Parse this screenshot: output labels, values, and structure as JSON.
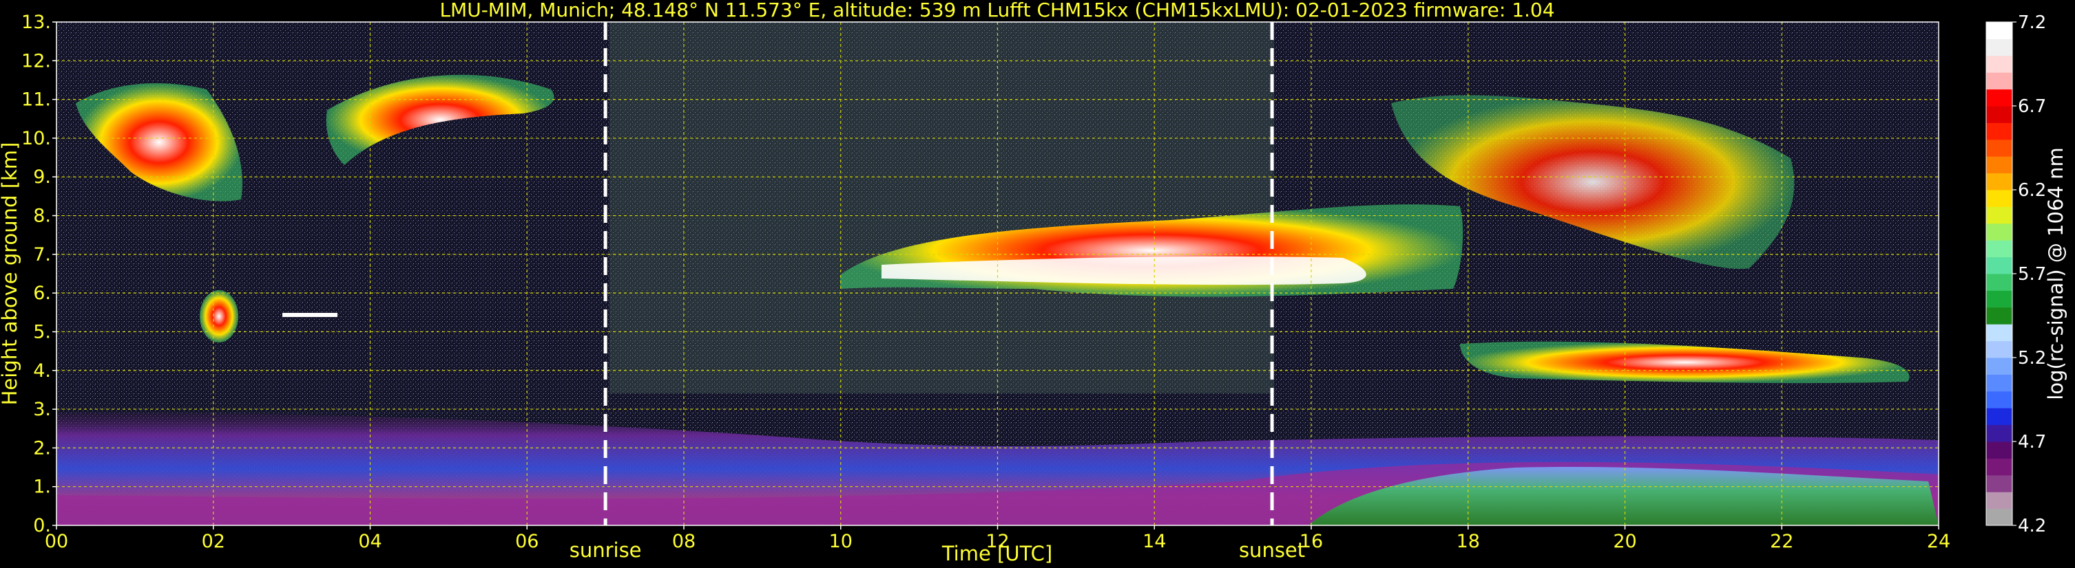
{
  "chart_data": {
    "type": "heatmap",
    "title": "LMU-MIM, Munich; 48.148° N 11.573° E, altitude: 539 m    Lufft CHM15kx (CHM15kxLMU): 02-01-2023    firmware: 1.04",
    "xlabel": "Time [UTC]",
    "ylabel": "Height above ground [km]",
    "xlim": [
      0,
      24
    ],
    "ylim": [
      0,
      13
    ],
    "x_ticks": [
      "00",
      "02",
      "04",
      "06",
      "08",
      "10",
      "12",
      "14",
      "16",
      "18",
      "20",
      "22",
      "24"
    ],
    "x_tick_values": [
      0,
      2,
      4,
      6,
      8,
      10,
      12,
      14,
      16,
      18,
      20,
      22,
      24
    ],
    "y_ticks": [
      "0.",
      "1.",
      "2.",
      "3.",
      "4.",
      "5.",
      "6.",
      "7.",
      "8.",
      "9.",
      "10.",
      "11.",
      "12.",
      "13."
    ],
    "y_tick_values": [
      0,
      1,
      2,
      3,
      4,
      5,
      6,
      7,
      8,
      9,
      10,
      11,
      12,
      13
    ],
    "grid": true,
    "annotations": [
      {
        "text": "sunrise",
        "x": 7.0
      },
      {
        "text": "sunset",
        "x": 15.5
      }
    ],
    "colorbar": {
      "label": "log(rc-signal) @ 1064 nm",
      "range": [
        4.2,
        7.2
      ],
      "ticks": [
        "4.2",
        "4.7",
        "5.2",
        "5.7",
        "6.2",
        "6.7",
        "7.2"
      ],
      "tick_values": [
        4.2,
        4.7,
        5.2,
        5.7,
        6.2,
        6.7,
        7.2
      ],
      "colors": [
        "#a8a8a8",
        "#b896b0",
        "#8a3f8a",
        "#7a187a",
        "#5a0a6a",
        "#3a1aa0",
        "#1a2ae0",
        "#3a6aff",
        "#5a8aff",
        "#7aa8ff",
        "#a8c8ff",
        "#c0e0ff",
        "#1a8a1a",
        "#1aaa3a",
        "#3ac86a",
        "#5ae0a0",
        "#7af0a0",
        "#a0f060",
        "#e0f020",
        "#ffe000",
        "#ffb000",
        "#ff8000",
        "#ff5000",
        "#ff2000",
        "#e00000",
        "#ff0000",
        "#ffb0b0",
        "#ffd8d8",
        "#f0f0f0",
        "#ffffff"
      ]
    },
    "features": [
      {
        "name": "boundary layer",
        "x": [
          0,
          24
        ],
        "height_km": [
          0,
          2.8
        ],
        "level": [
          4.4,
          4.9
        ]
      },
      {
        "name": "cirrus",
        "x": [
          0.3,
          6.5
        ],
        "height_km": [
          8.5,
          11.5
        ],
        "level": [
          5.2,
          6.5
        ]
      },
      {
        "name": "cloud",
        "x": [
          10,
          17
        ],
        "height_km": [
          6,
          8.5
        ],
        "level": [
          6.2,
          7.2
        ]
      },
      {
        "name": "cloud",
        "x": [
          17,
          23
        ],
        "height_km": [
          3.5,
          11
        ],
        "level": [
          5.0,
          7.0
        ]
      }
    ]
  }
}
